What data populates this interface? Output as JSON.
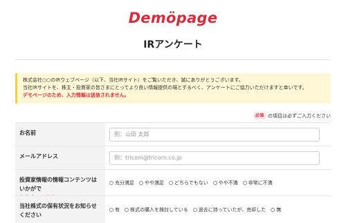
{
  "header": {
    "logo": "Demöpage",
    "title": "IRアンケート"
  },
  "notice": {
    "line1": "株式会社○○のIRウェブページ（以下、当社IRサイト）をご覧いただき、誠にありがとうございます。",
    "line2": "当社IRサイトを、株主・投資家の皆さまにとってより良い情報提供の場とするべく、アンケートにご協力いただけますと幸いです。",
    "warning": "デモページのため、入力情報は送信されません。"
  },
  "required_note": {
    "badge": "必須",
    "text": "の項目は必ずご入力ください"
  },
  "form": {
    "name": {
      "label": "お名前",
      "placeholder": "例：山田 太郎"
    },
    "email": {
      "label": "メールアドレス",
      "placeholder": "例：tricom@tricorn.co.jp"
    },
    "satisfaction": {
      "label_line1": "投資家情報の情報コンテンツはいかがで",
      "label_line2": "したか。",
      "badge": "必須",
      "options": [
        "充分満足",
        "やや満足",
        "どちらでもない",
        "やや不満",
        "非常に不満"
      ]
    },
    "holding": {
      "label": "当社株式の保有状況をお知らせください",
      "options": [
        "有",
        "株式の購入を検討している",
        "過去に持っていたが、売却した",
        "無"
      ]
    }
  }
}
